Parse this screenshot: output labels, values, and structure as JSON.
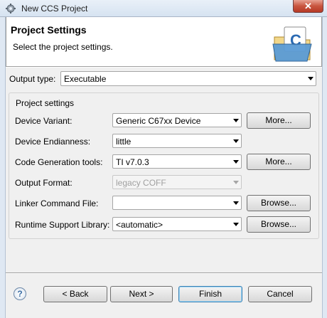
{
  "window": {
    "title": "New CCS Project",
    "close_label": "✕"
  },
  "header": {
    "title": "Project Settings",
    "subtitle": "Select the project settings."
  },
  "output_type": {
    "label": "Output type:",
    "value": "Executable"
  },
  "project_settings": {
    "group_label": "Project settings",
    "device_variant": {
      "label": "Device Variant:",
      "value": "Generic C67xx Device",
      "button": "More..."
    },
    "device_endianness": {
      "label": "Device Endianness:",
      "value": "little"
    },
    "code_generation": {
      "label": "Code Generation tools:",
      "value": "TI v7.0.3",
      "button": "More..."
    },
    "output_format": {
      "label": "Output Format:",
      "value": "legacy COFF"
    },
    "linker_command": {
      "label": "Linker Command File:",
      "value": "",
      "button": "Browse..."
    },
    "runtime_support": {
      "label": "Runtime Support Library:",
      "value": "<automatic>",
      "button": "Browse..."
    }
  },
  "footer": {
    "help": "?",
    "back": "< Back",
    "next": "Next >",
    "finish": "Finish",
    "cancel": "Cancel"
  },
  "colors": {
    "titlebar": "#d6e3f1",
    "accent": "#3c7fb1",
    "close": "#c8553f"
  }
}
